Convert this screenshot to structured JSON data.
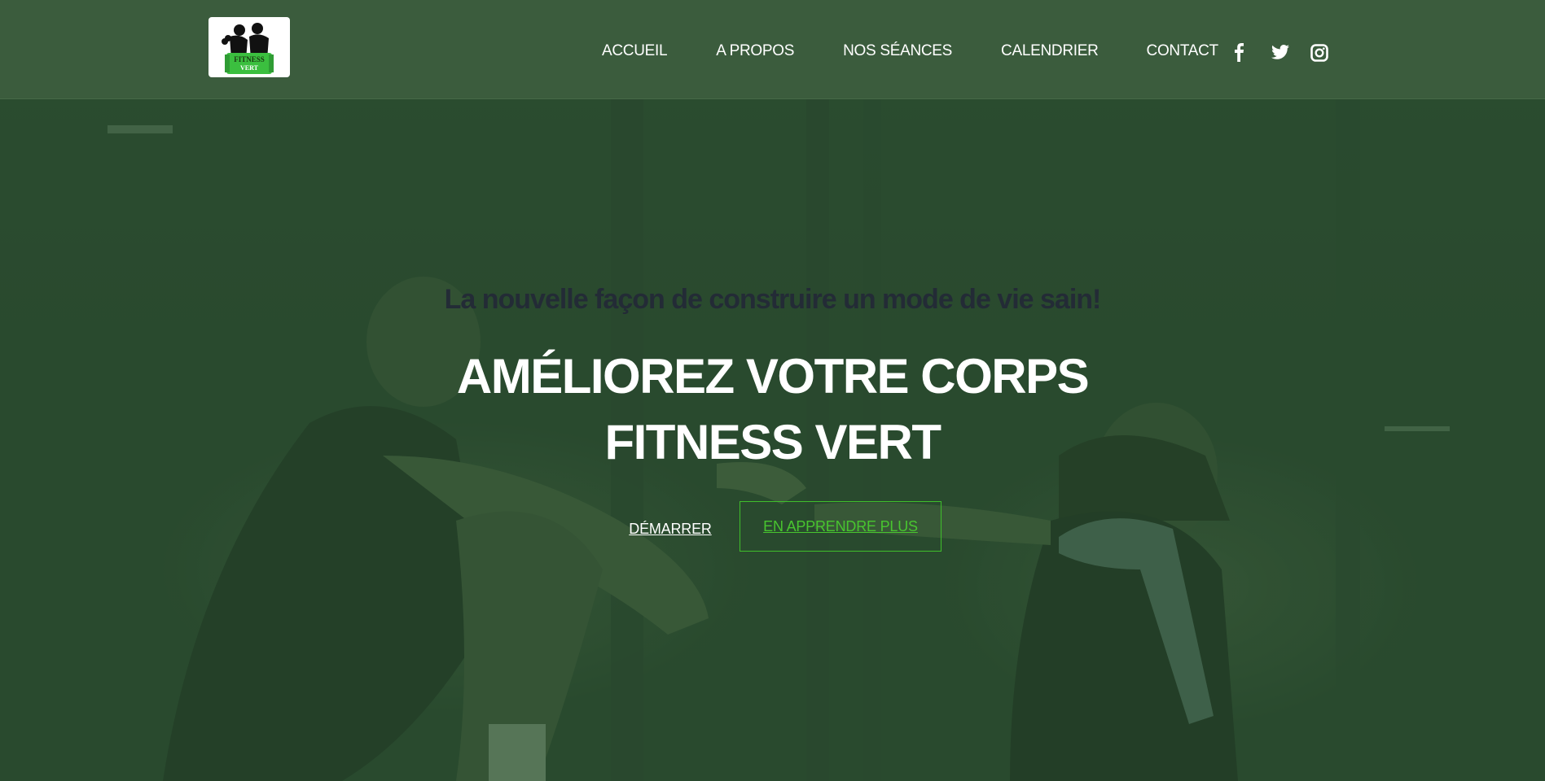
{
  "logo": {
    "text_top": "FITNESS",
    "text_bottom": "VERT"
  },
  "nav": {
    "items": [
      {
        "label": "ACCUEIL"
      },
      {
        "label": "A PROPOS"
      },
      {
        "label": "NOS SÉANCES"
      },
      {
        "label": "CALENDRIER"
      },
      {
        "label": "CONTACT"
      }
    ]
  },
  "social": {
    "icons": [
      "facebook-icon",
      "twitter-icon",
      "instagram-icon"
    ]
  },
  "hero": {
    "subtitle": "La nouvelle façon de construire un mode de vie sain!",
    "headline_line1": "AMÉLIOREZ VOTRE CORPS",
    "headline_line2": "FITNESS VERT",
    "primary_button": "DÉMARRER",
    "secondary_button": "EN APPRENDRE PLUS"
  },
  "colors": {
    "header_bg": "#3b5c3d",
    "overlay": "#2e4d31",
    "accent": "#48c52f",
    "subtitle": "#232b36"
  }
}
